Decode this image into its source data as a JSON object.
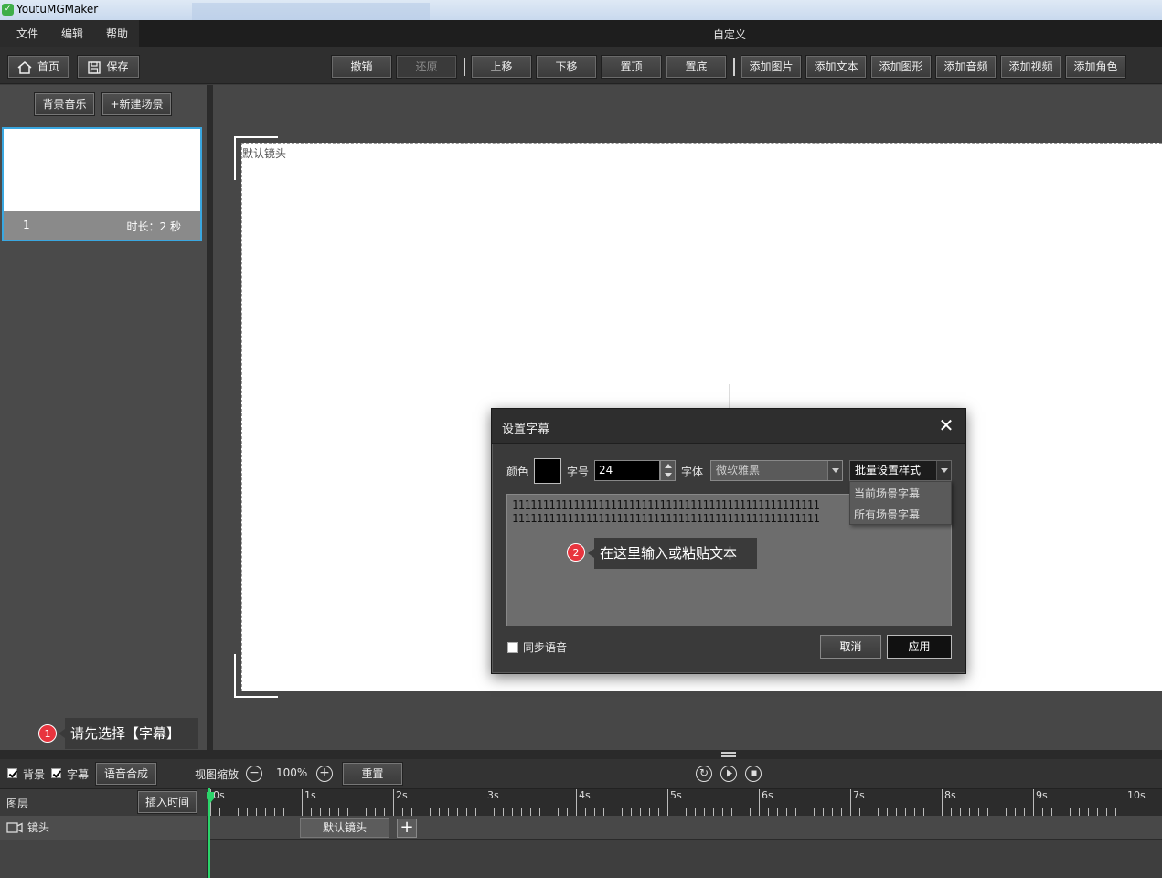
{
  "window": {
    "app_title": "YoutuMGMaker",
    "label": "自定义"
  },
  "menu": [
    "文件",
    "编辑",
    "帮助"
  ],
  "toolbar": {
    "home": "首页",
    "save": "保存",
    "undo": "撤销",
    "redo": "还原",
    "move_up": "上移",
    "move_down": "下移",
    "to_top": "置顶",
    "to_bottom": "置底",
    "add_image": "添加图片",
    "add_text": "添加文本",
    "add_shape": "添加图形",
    "add_audio": "添加音频",
    "add_video": "添加视频",
    "add_character": "添加角色"
  },
  "left_panel": {
    "bg_music": "背景音乐",
    "new_scene": "+新建场景",
    "scene": {
      "number": "1",
      "duration": "时长：2 秒"
    }
  },
  "canvas": {
    "camera_label": "默认镜头"
  },
  "dialog": {
    "title": "设置字幕",
    "color_label": "颜色",
    "color_value": "#000000",
    "size_label": "字号",
    "size_value": "24",
    "font_label": "字体",
    "font_value": "微软雅黑",
    "batch_value": "批量设置样式",
    "batch_options": [
      "当前场景字幕",
      "所有场景字幕"
    ],
    "text_lines": [
      "11111111111111111111111111111111111111111111111111",
      "11111111111111111111111111111111111111111111111111"
    ],
    "sync_label": "同步语音",
    "cancel": "取消",
    "apply": "应用"
  },
  "tips": {
    "tip1": {
      "num": "1",
      "text": "请先选择【字幕】"
    },
    "tip2": {
      "num": "2",
      "text": "在这里输入或粘贴文本"
    }
  },
  "bottom": {
    "bg_check": "背景",
    "subtitle_check": "字幕",
    "tts": "语音合成",
    "zoom_label": "视图缩放",
    "zoom_value": "100%",
    "reset": "重置",
    "layer_label": "图层",
    "insert_time": "插入时间",
    "track_name": "镜头",
    "clip_label": "默认镜头",
    "ruler_labels": [
      "0s",
      "1s",
      "2s",
      "3s",
      "4s",
      "5s",
      "6s",
      "7s",
      "8s",
      "9s",
      "10s"
    ]
  },
  "colors": {
    "accent_selection": "#3aa7e0",
    "playhead": "#2bd46a",
    "badge": "#e8343e"
  }
}
